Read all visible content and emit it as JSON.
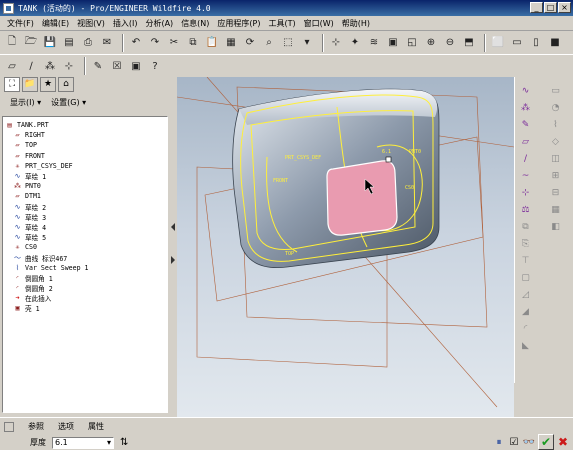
{
  "window": {
    "title": "TANK (活动的) - Pro/ENGINEER Wildfire 4.0",
    "controls": [
      "_",
      "□",
      "×"
    ]
  },
  "menu": [
    "文件(F)",
    "编辑(E)",
    "视图(V)",
    "插入(I)",
    "分析(A)",
    "信息(N)",
    "应用程序(P)",
    "工具(T)",
    "窗口(W)",
    "帮助(H)"
  ],
  "panel": {
    "show_label": "显示(I) ▾",
    "settings_label": "设置(G) ▾"
  },
  "tree": [
    {
      "icon": "part",
      "label": "TANK.PRT"
    },
    {
      "icon": "datum-plane",
      "label": "RIGHT"
    },
    {
      "icon": "datum-plane",
      "label": "TOP"
    },
    {
      "icon": "datum-plane",
      "label": "FRONT"
    },
    {
      "icon": "csys",
      "label": "PRT_CSYS_DEF"
    },
    {
      "icon": "sketch",
      "label": "草绘 1"
    },
    {
      "icon": "point",
      "label": "PNT0"
    },
    {
      "icon": "datum-plane",
      "label": "DTM1"
    },
    {
      "icon": "sketch",
      "label": "草绘 2"
    },
    {
      "icon": "sketch",
      "label": "草绘 3"
    },
    {
      "icon": "sketch",
      "label": "草绘 4"
    },
    {
      "icon": "sketch",
      "label": "草绘 5"
    },
    {
      "icon": "csys",
      "label": "CS0"
    },
    {
      "icon": "curve",
      "label": "曲线 标识467"
    },
    {
      "icon": "sweep",
      "label": "Var Sect Sweep 1"
    },
    {
      "icon": "round",
      "label": "倒圆角 1"
    },
    {
      "icon": "round",
      "label": "倒圆角 2"
    },
    {
      "icon": "insert",
      "label": "在此插入"
    },
    {
      "icon": "shell",
      "label": "壳 1"
    }
  ],
  "dashboard": {
    "tabs": [
      "参照",
      "选项",
      "属性"
    ],
    "thickness_label": "厚度",
    "thickness_value": "6.1"
  },
  "viewport_labels": {
    "csys": "PRT_CSYS_DEF",
    "dim": "6.1",
    "pnt": "PNT0",
    "front": "FRONT",
    "cs": "CS0",
    "top": "TOP"
  }
}
